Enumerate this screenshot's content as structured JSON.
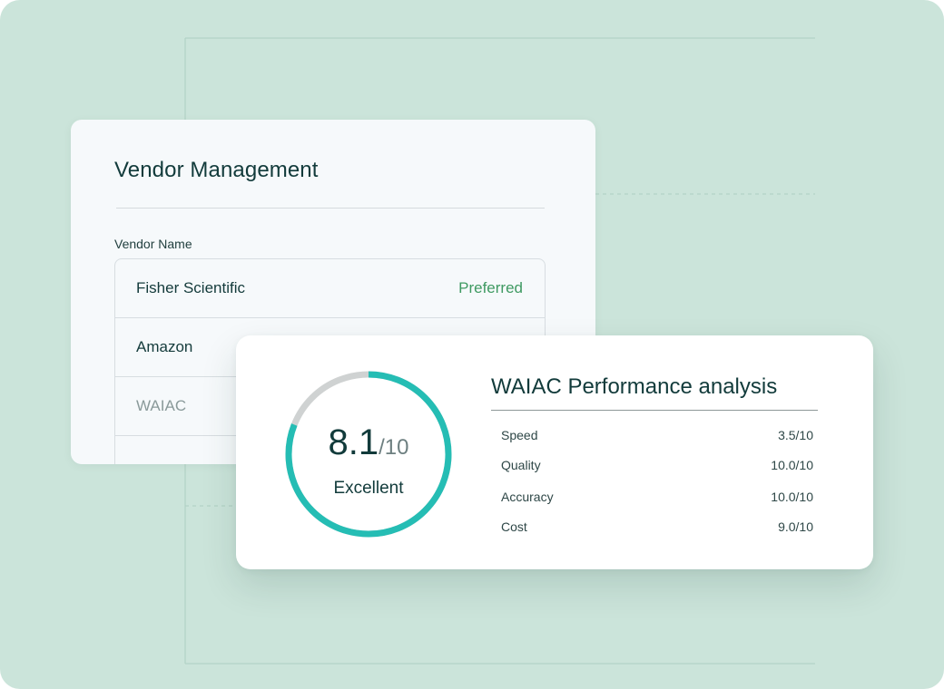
{
  "vendor_panel": {
    "title": "Vendor Management",
    "field_label": "Vendor Name",
    "vendors": [
      {
        "name": "Fisher Scientific",
        "status": "Preferred"
      },
      {
        "name": "Amazon",
        "status": ""
      },
      {
        "name": "WAIAC",
        "status": ""
      }
    ]
  },
  "performance_panel": {
    "title": "WAIAC Performance analysis",
    "score": "8.1",
    "score_max": "/10",
    "score_fraction": 0.81,
    "rating": "Excellent",
    "metrics": [
      {
        "label": "Speed",
        "value": "3.5/10"
      },
      {
        "label": "Quality",
        "value": "10.0/10"
      },
      {
        "label": "Accuracy",
        "value": "10.0/10"
      },
      {
        "label": "Cost",
        "value": "9.0/10"
      }
    ]
  },
  "colors": {
    "background": "#cbe4da",
    "accent": "#25bdb4",
    "gauge_track": "#cfd2d2",
    "preferred": "#3f9a62"
  }
}
